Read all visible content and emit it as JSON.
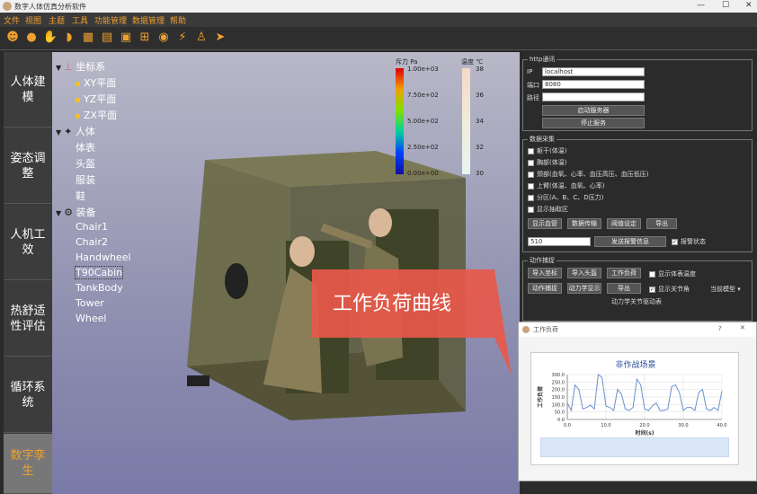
{
  "window": {
    "title": "数字人体仿真分析软件",
    "min": "—",
    "max": "☐",
    "close": "✕"
  },
  "menu": [
    "文件",
    "视图",
    "主题",
    "工具",
    "功能管理",
    "数据管理",
    "帮助"
  ],
  "toolbar_icons": [
    "person-icon",
    "head-icon",
    "hand-icon",
    "helmet-icon",
    "body-mesh-icon",
    "grid-icon",
    "camera-icon",
    "hierarchy-icon",
    "eye-icon",
    "run-icon",
    "shirt-icon",
    "arrow-icon"
  ],
  "sidebar": [
    {
      "label": "人体建模"
    },
    {
      "label": "姿态调整"
    },
    {
      "label": "人机工效"
    },
    {
      "label": "热舒适性评估"
    },
    {
      "label": "循环系统"
    },
    {
      "label": "数字孪生"
    }
  ],
  "tree": {
    "coord": "坐标系",
    "coord_items": [
      "XY平面",
      "YZ平面",
      "ZX平面"
    ],
    "human": "人体",
    "human_items": [
      "体表",
      "头盔",
      "服装",
      "鞋"
    ],
    "equip": "装备",
    "equip_items": [
      "Chair1",
      "Chair2",
      "Handwheel",
      "T90Cabin",
      "TankBody",
      "Tower",
      "Wheel"
    ]
  },
  "colorbar_pressure": {
    "label": "斥力 Pa",
    "ticks": [
      "1.00e+03",
      "7.50e+02",
      "5.00e+02",
      "2.50e+02",
      "0.00e+00"
    ]
  },
  "colorbar_temp": {
    "label": "温度 ℃",
    "ticks": [
      "38",
      "36",
      "34",
      "32",
      "30"
    ]
  },
  "callout": "工作负荷曲线",
  "http": {
    "title": "http通讯",
    "ip_label": "IP",
    "ip_value": "localhost",
    "port_label": "端口",
    "port_value": "8080",
    "path_label": "路径",
    "path_value": "",
    "start_btn": "启动服务器",
    "stop_btn": "停止服务"
  },
  "collect": {
    "title": "数据采集",
    "items": [
      "躯干(体温)",
      "胸部(体温)",
      "颈部(血氧、心率、血压高压、血压低压)",
      "上臂(体温、血氧、心率)",
      "分区(A、B、C、D压力)",
      "显示抽取区"
    ],
    "btns": [
      "显示血管",
      "数据传输",
      "阈值设定",
      "导出"
    ],
    "input_value": "510",
    "send_btn": "发送报警信息",
    "alarm_chk": "报警状态"
  },
  "motion": {
    "title": "动作捕捉",
    "row1": [
      "导入坐标",
      "导入头盔",
      "工作负荷"
    ],
    "chk1": "显示体表温度",
    "row2": [
      "动作捕捉",
      "动力学显示",
      "导出"
    ],
    "chk2": "显示关节角",
    "select": "当前模型",
    "sub": "动力学关节驱动表"
  },
  "dialog": {
    "title": "工作负荷",
    "help": "?",
    "close": "✕"
  },
  "chart_data": {
    "type": "line",
    "title": "非作战场景",
    "xlabel": "时间(s)",
    "ylabel": "工作负荷",
    "xlim": [
      0,
      40
    ],
    "ylim": [
      0,
      300
    ],
    "xticks": [
      "0.0",
      "10.0",
      "20.0",
      "30.0",
      "40.0"
    ],
    "yticks": [
      "0.0",
      "50.0",
      "100.0",
      "150.0",
      "200.0",
      "250.0",
      "300.0"
    ],
    "grid": true,
    "color": "#6a8fd0",
    "x": [
      0,
      1,
      2,
      3,
      4,
      5,
      6,
      7,
      8,
      9,
      10,
      11,
      12,
      13,
      14,
      15,
      16,
      17,
      18,
      19,
      20,
      21,
      22,
      23,
      24,
      25,
      26,
      27,
      28,
      29,
      30,
      31,
      32,
      33,
      34,
      35,
      36,
      37,
      38,
      39,
      40
    ],
    "y": [
      110,
      60,
      230,
      200,
      70,
      80,
      95,
      70,
      320,
      280,
      90,
      80,
      60,
      200,
      170,
      70,
      60,
      80,
      270,
      230,
      70,
      60,
      90,
      110,
      60,
      60,
      70,
      220,
      230,
      180,
      60,
      80,
      80,
      60,
      180,
      200,
      70,
      60,
      80,
      60,
      190
    ]
  }
}
